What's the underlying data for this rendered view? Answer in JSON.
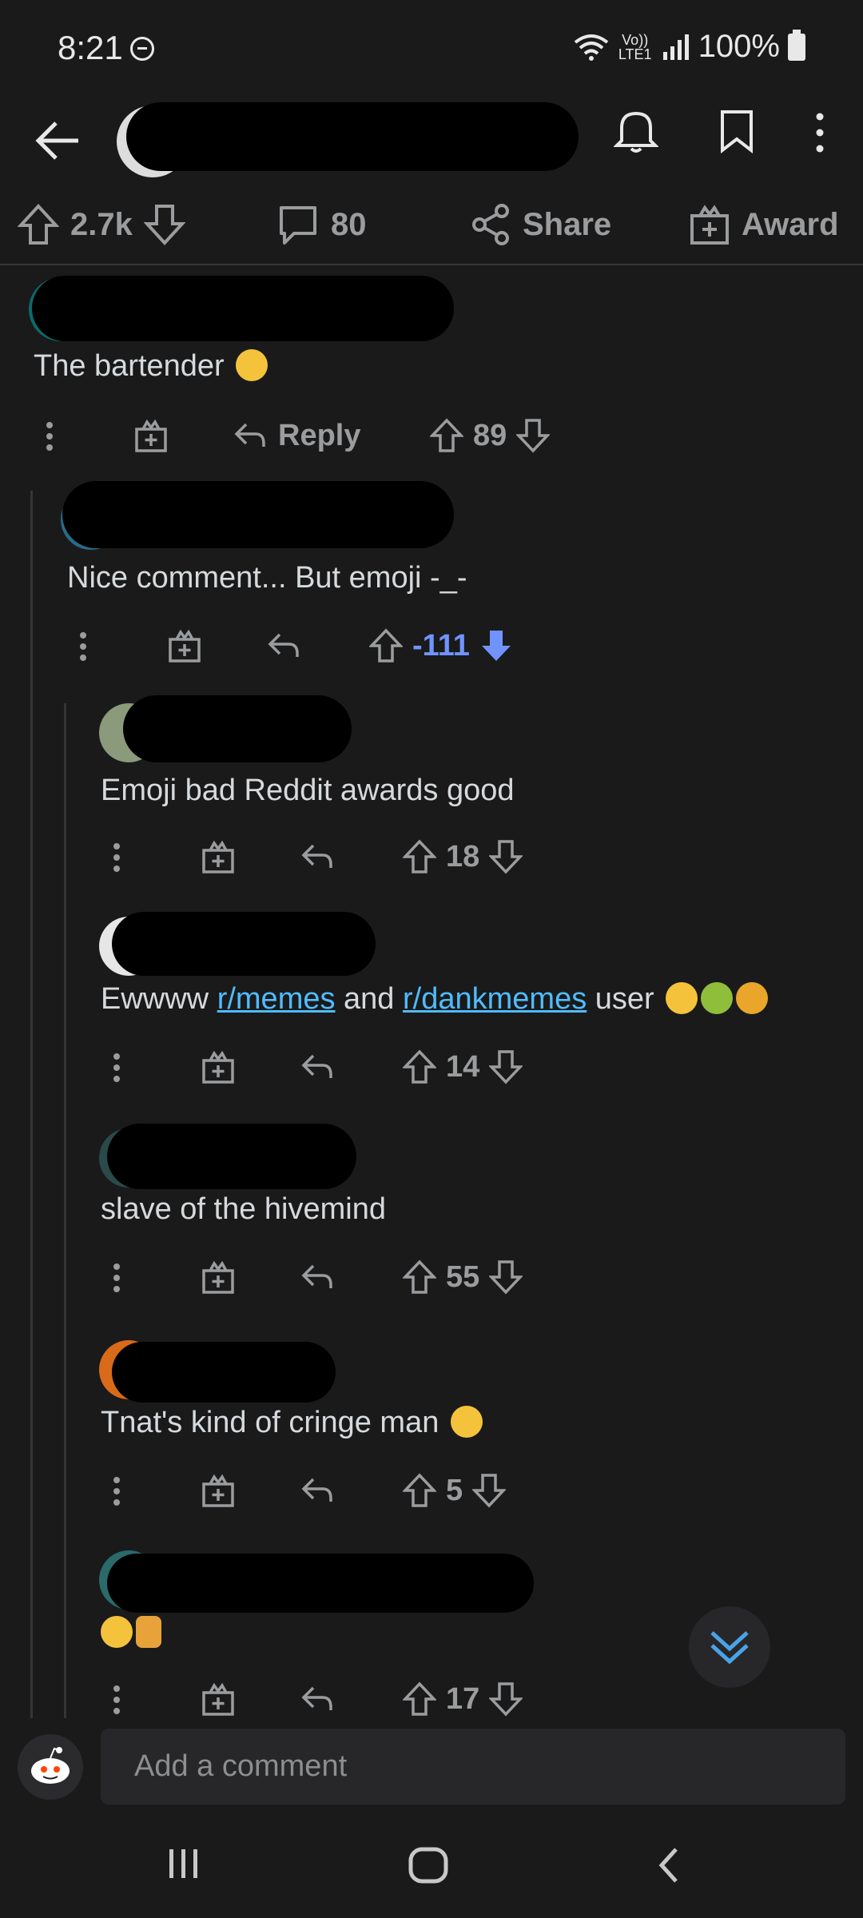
{
  "status_bar": {
    "time": "8:21",
    "network": "Vo)) LTE1",
    "battery": "100%"
  },
  "header": {
    "icons": [
      "back-arrow-icon",
      "notification-bell-icon",
      "bookmark-icon",
      "more-vert-icon"
    ]
  },
  "post_actions": {
    "score": "2.7k",
    "comments": "80",
    "share_label": "Share",
    "award_label": "Award"
  },
  "comments": [
    {
      "text": "The bartender",
      "reply_label": "Reply",
      "score": "89"
    },
    {
      "text": "Nice comment... But emoji -_-",
      "score": "-111",
      "vote": "downvoted"
    },
    {
      "text": "Emoji bad Reddit awards good",
      "score": "18"
    },
    {
      "text_prefix": "Ewwww ",
      "link1": "r/memes",
      "text_mid": " and ",
      "link2": "r/dankmemes",
      "text_suffix": " user",
      "score": "14"
    },
    {
      "text": "slave of the hivemind",
      "score": "55"
    },
    {
      "text": "Tnat's kind of cringe man",
      "score": "5"
    },
    {
      "text": "",
      "score": "17"
    }
  ],
  "composer": {
    "placeholder": "Add a comment"
  },
  "colors": {
    "background": "#1a1a1b",
    "link": "#4fbcff",
    "downvote": "#7193ff",
    "muted": "#9a9c9e"
  }
}
